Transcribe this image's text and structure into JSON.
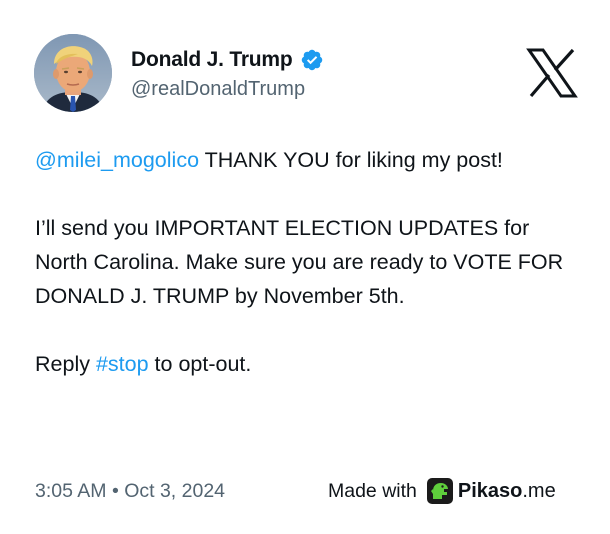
{
  "tweet": {
    "author": {
      "display_name": "Donald J. Trump",
      "handle": "@realDonaldTrump",
      "verified": true,
      "avatar_icon": "profile-photo"
    },
    "platform_icon": "x-logo-icon",
    "body": {
      "mention": "@milei_mogolico",
      "line1_rest": " THANK YOU for liking my post!",
      "paragraph2": "I’ll send you IMPORTANT ELECTION UPDATES for North Carolina. Make sure you are ready to VOTE FOR DONALD J. TRUMP by November 5th.",
      "reply_prefix": "Reply ",
      "hashtag": "#stop",
      "reply_suffix": " to opt-out."
    },
    "timestamp": "3:05 AM • Oct 3, 2024"
  },
  "footer": {
    "made_with_label": "Made with",
    "brand_name": "Pikaso",
    "brand_tld": ".me",
    "brand_icon": "pikaso-dino-icon"
  },
  "colors": {
    "link": "#1d9bf0",
    "verified_badge": "#1d9bf0",
    "secondary_text": "#536471",
    "primary_text": "#0f1419",
    "pikaso_green": "#5fcf3c"
  }
}
